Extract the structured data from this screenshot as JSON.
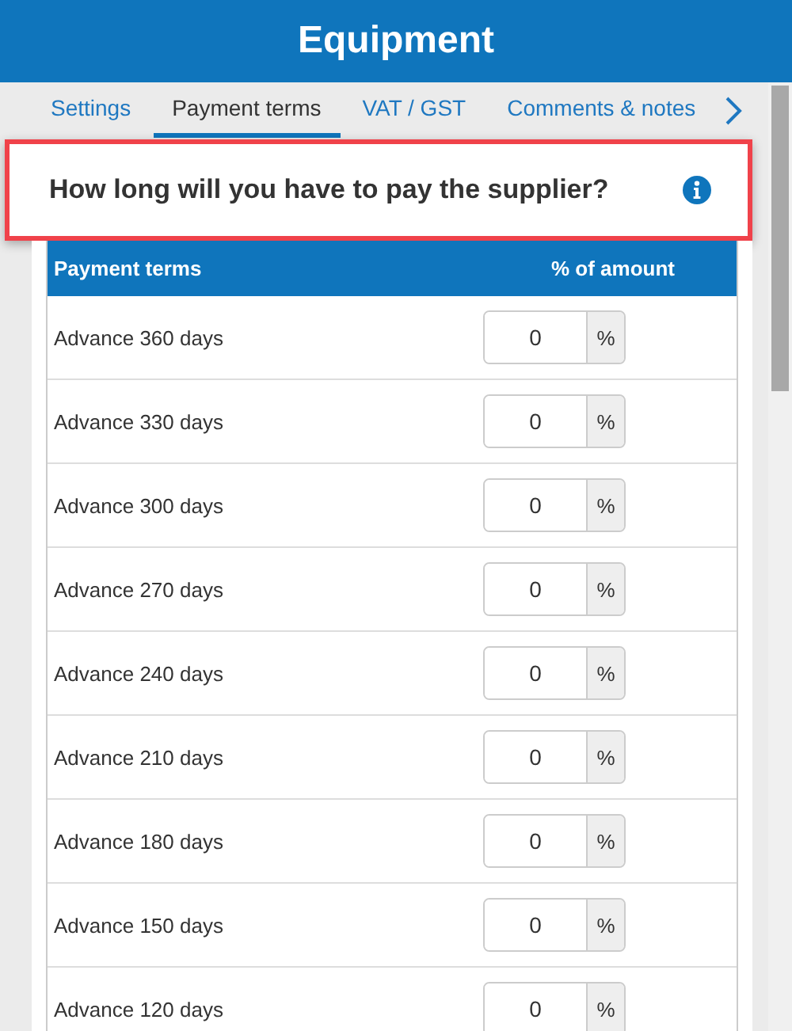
{
  "header": {
    "title": "Equipment"
  },
  "tabs": [
    {
      "label": "Settings",
      "selected": false
    },
    {
      "label": "Payment terms",
      "selected": true
    },
    {
      "label": "VAT / GST",
      "selected": false
    },
    {
      "label": "Comments & notes",
      "selected": false
    }
  ],
  "question": {
    "text": "How long will you have to pay the supplier?",
    "highlighted": true
  },
  "table": {
    "columns": [
      "Payment terms",
      "% of amount"
    ],
    "rows": [
      {
        "term": "Advance 360 days",
        "value": "0",
        "unit": "%"
      },
      {
        "term": "Advance 330 days",
        "value": "0",
        "unit": "%"
      },
      {
        "term": "Advance 300 days",
        "value": "0",
        "unit": "%"
      },
      {
        "term": "Advance 270 days",
        "value": "0",
        "unit": "%"
      },
      {
        "term": "Advance 240 days",
        "value": "0",
        "unit": "%"
      },
      {
        "term": "Advance 210 days",
        "value": "0",
        "unit": "%"
      },
      {
        "term": "Advance 180 days",
        "value": "0",
        "unit": "%"
      },
      {
        "term": "Advance 150 days",
        "value": "0",
        "unit": "%"
      },
      {
        "term": "Advance 120 days",
        "value": "0",
        "unit": "%"
      }
    ]
  }
}
